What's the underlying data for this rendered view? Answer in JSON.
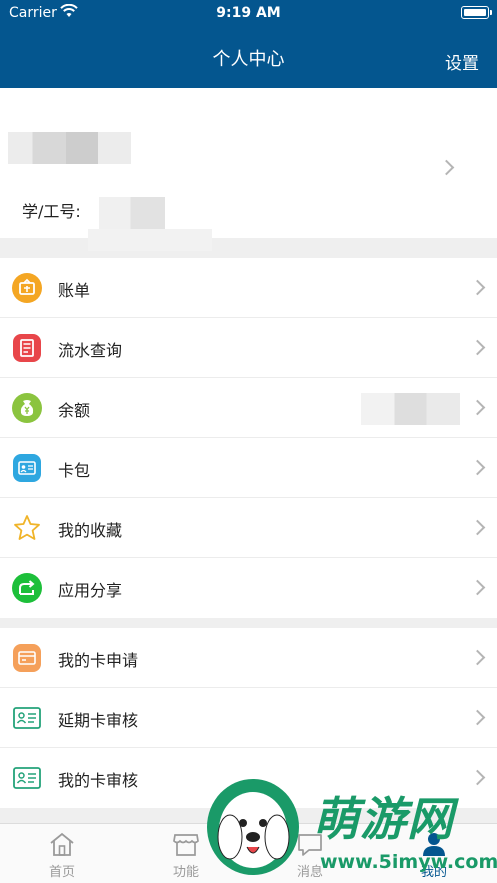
{
  "status_bar": {
    "carrier": "Carrier",
    "time": "9:19 AM"
  },
  "nav": {
    "title": "个人中心",
    "settings": "设置"
  },
  "profile": {
    "id_label": "学/工号:"
  },
  "menu": [
    {
      "label": "账单",
      "icon": "bill-icon"
    },
    {
      "label": "流水查询",
      "icon": "transactions-icon"
    },
    {
      "label": "余额",
      "icon": "balance-icon"
    },
    {
      "label": "卡包",
      "icon": "card-wallet-icon"
    },
    {
      "label": "我的收藏",
      "icon": "star-icon"
    },
    {
      "label": "应用分享",
      "icon": "share-icon"
    }
  ],
  "cards": [
    {
      "label": "我的卡申请",
      "icon": "card-apply-icon"
    },
    {
      "label": "延期卡审核",
      "icon": "id-card-icon"
    },
    {
      "label": "我的卡审核",
      "icon": "id-card-icon"
    }
  ],
  "tabs": [
    {
      "label": "首页",
      "icon": "home-icon",
      "active": false
    },
    {
      "label": "功能",
      "icon": "store-icon",
      "active": false
    },
    {
      "label": "消息",
      "icon": "message-icon",
      "active": false
    },
    {
      "label": "我的",
      "icon": "user-icon",
      "active": true
    }
  ],
  "watermark": {
    "title": "萌游网",
    "url": "www.5imyw.com"
  },
  "colors": {
    "primary": "#04568f",
    "background": "#efefef"
  }
}
